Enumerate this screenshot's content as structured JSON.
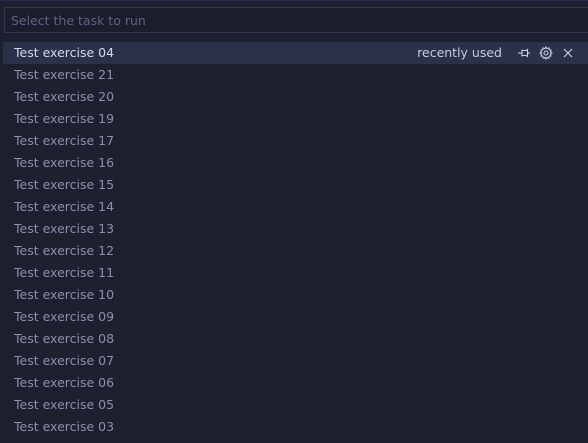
{
  "search": {
    "placeholder": "Select the task to run",
    "value": ""
  },
  "selected_item": {
    "label": "Test exercise 04",
    "badge": "recently used",
    "actions": [
      "pin-icon",
      "gear-icon",
      "close-icon"
    ]
  },
  "items": [
    {
      "label": "Test exercise 21"
    },
    {
      "label": "Test exercise 20"
    },
    {
      "label": "Test exercise 19"
    },
    {
      "label": "Test exercise 17"
    },
    {
      "label": "Test exercise 16"
    },
    {
      "label": "Test exercise 15"
    },
    {
      "label": "Test exercise 14"
    },
    {
      "label": "Test exercise 13"
    },
    {
      "label": "Test exercise 12"
    },
    {
      "label": "Test exercise 11"
    },
    {
      "label": "Test exercise 10"
    },
    {
      "label": "Test exercise 09"
    },
    {
      "label": "Test exercise 08"
    },
    {
      "label": "Test exercise 07"
    },
    {
      "label": "Test exercise 06"
    },
    {
      "label": "Test exercise 05"
    },
    {
      "label": "Test exercise 03"
    }
  ],
  "colors": {
    "background": "#1e2030",
    "selected_row": "#2c3149",
    "text": "#8b90a8",
    "text_selected": "#d4d7ea"
  }
}
